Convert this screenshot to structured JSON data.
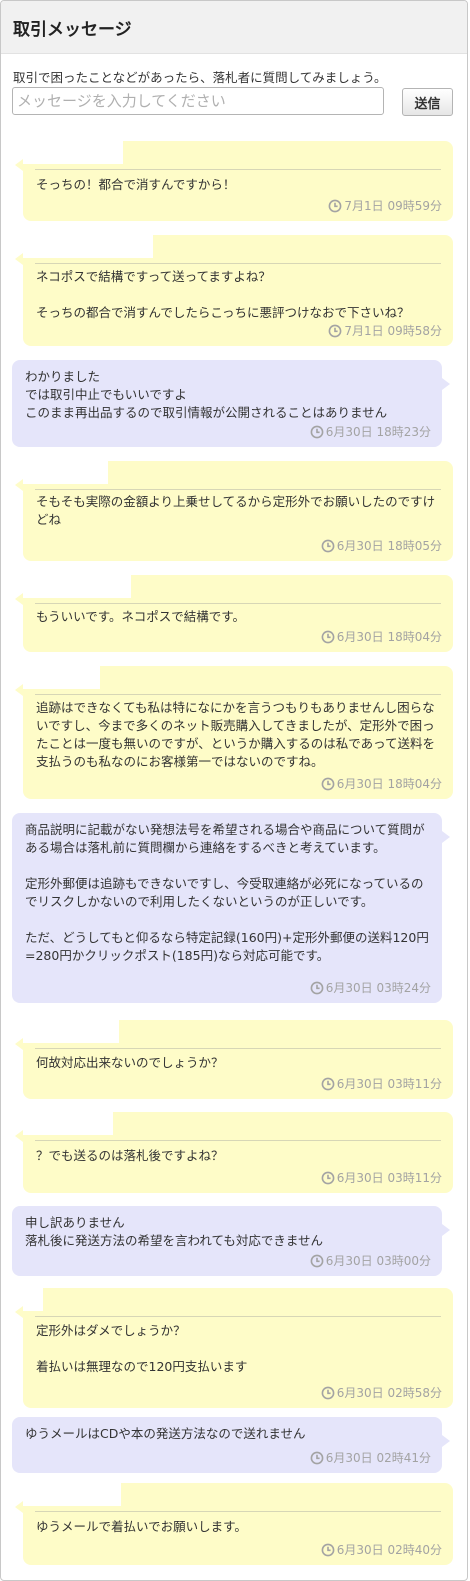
{
  "header": {
    "title": "取引メッセージ"
  },
  "intro": "取引で困ったことなどがあったら、落札者に質問してみましょう。",
  "compose": {
    "placeholder": "メッセージを入力してください",
    "send_label": "送信"
  },
  "icons": {
    "timestamp": "clock-icon"
  },
  "colors": {
    "buyer_bubble": "#fefcc8",
    "seller_bubble": "#e5e5fa"
  },
  "messages": [
    {
      "side": "buyer",
      "text": "そっちの！都合で消すんですから！",
      "time": "7月1日 09時59分"
    },
    {
      "side": "buyer",
      "text": "ネコポスで結構ですって送ってますよね？\n\nそっちの都合で消すんでしたらこっちに悪評つけなおで下さいね？",
      "time": "7月1日 09時58分"
    },
    {
      "side": "seller",
      "text": "わかりました\nでは取引中止でもいいですよ\nこのまま再出品するので取引情報が公開されることはありません",
      "time": "6月30日 18時23分"
    },
    {
      "side": "buyer",
      "text": "そもそも実際の金額より上乗せしてるから定形外でお願いしたのですけどね",
      "time": "6月30日 18時05分"
    },
    {
      "side": "buyer",
      "text": "もういいです。ネコポスで結構です。",
      "time": "6月30日 18時04分"
    },
    {
      "side": "buyer",
      "text": "追跡はできなくても私は特になにかを言うつもりもありませんし困らないですし、今まで多くのネット販売購入してきましたが、定形外で困ったことは一度も無いのですが、というか購入するのは私であって送料を支払うのも私なのにお客様第一ではないのですね。",
      "time": "6月30日 18時04分"
    },
    {
      "side": "seller",
      "text": "商品説明に記載がない発想法号を希望される場合や商品について質問がある場合は落札前に質問欄から連絡をするべきと考えています。\n\n定形外郵便は追跡もできないですし、今受取連絡が必死になっているのでリスクしかないので利用したくないというのが正しいです。\n\nただ、どうしてもと仰るなら特定記録(160円)+定形外郵便の送料120円=280円かクリックポスト(185円)なら対応可能です。",
      "time": "6月30日 03時24分"
    },
    {
      "side": "buyer",
      "text": "何故対応出来ないのでしょうか？",
      "time": "6月30日 03時11分"
    },
    {
      "side": "buyer",
      "text": "？でも送るのは落札後ですよね？",
      "time": "6月30日 03時11分"
    },
    {
      "side": "seller",
      "text": "申し訳ありません\n落札後に発送方法の希望を言われても対応できません",
      "time": "6月30日 03時00分"
    },
    {
      "side": "buyer",
      "text": "定形外はダメでしょうか？\n\n着払いは無理なので120円支払います",
      "time": "6月30日 02時58分"
    },
    {
      "side": "seller",
      "text": "ゆうメールはCDや本の発送方法なので送れません",
      "time": "6月30日 02時41分"
    },
    {
      "side": "buyer",
      "text": "ゆうメールで着払いでお願いします。",
      "time": "6月30日 02時40分"
    }
  ]
}
